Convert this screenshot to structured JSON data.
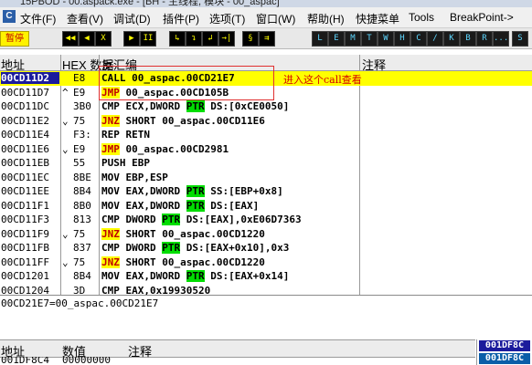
{
  "window": {
    "title": "15PBOD - 00.aspack.exe - [BH - 主线程, 模块 - 00_aspac]"
  },
  "menu": {
    "items": [
      "文件(F)",
      "查看(V)",
      "调试(D)",
      "插件(P)",
      "选项(T)",
      "窗口(W)",
      "帮助(H)",
      "快捷菜单",
      "Tools",
      "BreakPoint->"
    ]
  },
  "toolbar": {
    "pause_label": "暂停",
    "debug_buttons": [
      "◀◀",
      "◀",
      "X",
      "▶",
      "II",
      "↳",
      "↴",
      "↲",
      "→|",
      "§",
      "⇉"
    ],
    "window_buttons": [
      "L",
      "E",
      "M",
      "T",
      "W",
      "H",
      "C",
      "/",
      "K",
      "B",
      "R",
      "...",
      "S"
    ]
  },
  "disasm": {
    "headers": {
      "address": "地址",
      "hex": "HEX 数据",
      "disasm": "反汇编",
      "comment": "注释"
    },
    "rows": [
      {
        "addr": "00CD11D2",
        "arrow": "",
        "hex": "E8",
        "mn": "CALL",
        "ops": "00_aspac.00CD21E7",
        "comment": "进入这个call查看",
        "selected": true
      },
      {
        "addr": "00CD11D7",
        "arrow": "^",
        "hex": "E9",
        "mn": "JMP",
        "ops": "00_aspac.00CD105B",
        "comment": "",
        "selected": false
      },
      {
        "addr": "00CD11DC",
        "arrow": "",
        "hex": "3B0",
        "mn": "CMP",
        "ops": "ECX,DWORD PTR DS:[0xCE0050]",
        "comment": "",
        "selected": false
      },
      {
        "addr": "00CD11E2",
        "arrow": "⌄",
        "hex": "75",
        "mn": "JNZ",
        "ops": "SHORT 00_aspac.00CD11E6",
        "comment": "",
        "selected": false
      },
      {
        "addr": "00CD11E4",
        "arrow": "",
        "hex": "F3:",
        "mn": "REP",
        "ops": "RETN",
        "comment": "",
        "selected": false
      },
      {
        "addr": "00CD11E6",
        "arrow": "⌄",
        "hex": "E9",
        "mn": "JMP",
        "ops": "00_aspac.00CD2981",
        "comment": "",
        "selected": false
      },
      {
        "addr": "00CD11EB",
        "arrow": "",
        "hex": "55",
        "mn": "PUSH",
        "ops": "EBP",
        "comment": "",
        "selected": false
      },
      {
        "addr": "00CD11EC",
        "arrow": "",
        "hex": "8BE",
        "mn": "MOV",
        "ops": "EBP,ESP",
        "comment": "",
        "selected": false
      },
      {
        "addr": "00CD11EE",
        "arrow": "",
        "hex": "8B4",
        "mn": "MOV",
        "ops": "EAX,DWORD PTR SS:[EBP+0x8]",
        "comment": "",
        "selected": false
      },
      {
        "addr": "00CD11F1",
        "arrow": "",
        "hex": "8B0",
        "mn": "MOV",
        "ops": "EAX,DWORD PTR DS:[EAX]",
        "comment": "",
        "selected": false
      },
      {
        "addr": "00CD11F3",
        "arrow": "",
        "hex": "813",
        "mn": "CMP",
        "ops": "DWORD PTR DS:[EAX],0xE06D7363",
        "comment": "",
        "selected": false
      },
      {
        "addr": "00CD11F9",
        "arrow": "⌄",
        "hex": "75",
        "mn": "JNZ",
        "ops": "SHORT 00_aspac.00CD1220",
        "comment": "",
        "selected": false
      },
      {
        "addr": "00CD11FB",
        "arrow": "",
        "hex": "837",
        "mn": "CMP",
        "ops": "DWORD PTR DS:[EAX+0x10],0x3",
        "comment": "",
        "selected": false
      },
      {
        "addr": "00CD11FF",
        "arrow": "⌄",
        "hex": "75",
        "mn": "JNZ",
        "ops": "SHORT 00_aspac.00CD1220",
        "comment": "",
        "selected": false
      },
      {
        "addr": "00CD1201",
        "arrow": "",
        "hex": "8B4",
        "mn": "MOV",
        "ops": "EAX,DWORD PTR DS:[EAX+0x14]",
        "comment": "",
        "selected": false
      },
      {
        "addr": "00CD1204",
        "arrow": "",
        "hex": "3D",
        "mn": "CMP",
        "ops": "EAX,0x19930520",
        "comment": "",
        "selected": false
      }
    ]
  },
  "status_line": "00CD21E7=00_aspac.00CD21E7",
  "dump": {
    "headers": {
      "address": "地址",
      "value": "数值",
      "comment": "注释"
    },
    "row": {
      "addr": "001DF8C4",
      "value": "00000000"
    }
  },
  "stack": {
    "top": "001DF8C",
    "next": "001DF8C"
  },
  "colors": {
    "selected_addr_bg": "#1b1b9c",
    "highlight": "#ffff00",
    "ptr_bg": "#00dd00",
    "jump_text": "#c00000",
    "annotation": "#e03030"
  }
}
